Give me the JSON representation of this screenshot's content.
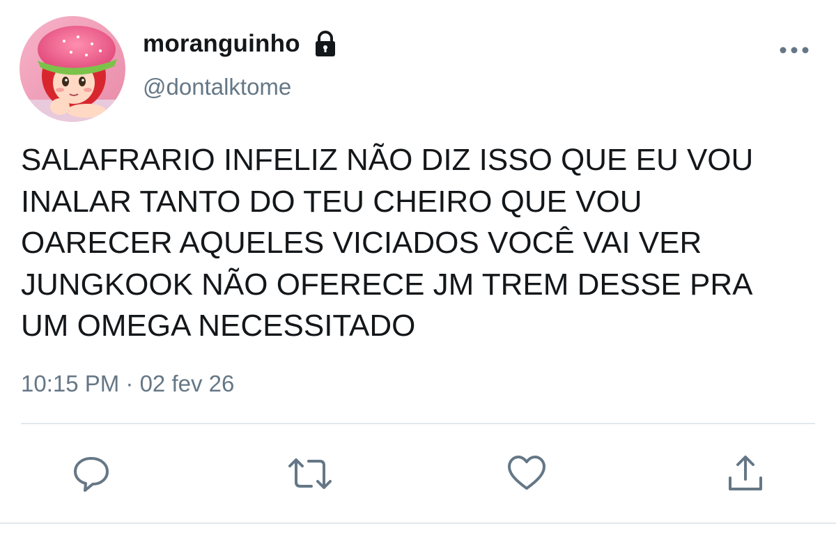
{
  "user": {
    "display_name": "moranguinho",
    "handle": "@dontalktome",
    "protected_icon": "lock-icon",
    "avatar": "strawberry-shortcake-avatar"
  },
  "tweet": {
    "text": "SALAFRARIO INFELIZ NÃO DIZ ISSO QUE EU VOU\nINALAR TANTO DO TEU CHEIRO QUE VOU\nOARECER AQUELES VICIADOS VOCÊ VAI VER\nJUNGKOOK NÃO OFERECE JM TREM DESSE PRA\nUM OMEGA NECESSITADO",
    "timestamp": "10:15 PM · 02 fev 26"
  },
  "actions": [
    {
      "name": "reply",
      "icon": "speech-bubble-icon"
    },
    {
      "name": "retweet",
      "icon": "retweet-icon"
    },
    {
      "name": "like",
      "icon": "heart-icon"
    },
    {
      "name": "share",
      "icon": "share-icon"
    }
  ],
  "menu_icon": "more-horizontal-icon",
  "colors": {
    "text": "#14171a",
    "secondary": "#657786",
    "divider": "#e1e8ed",
    "icon": "#657786"
  }
}
